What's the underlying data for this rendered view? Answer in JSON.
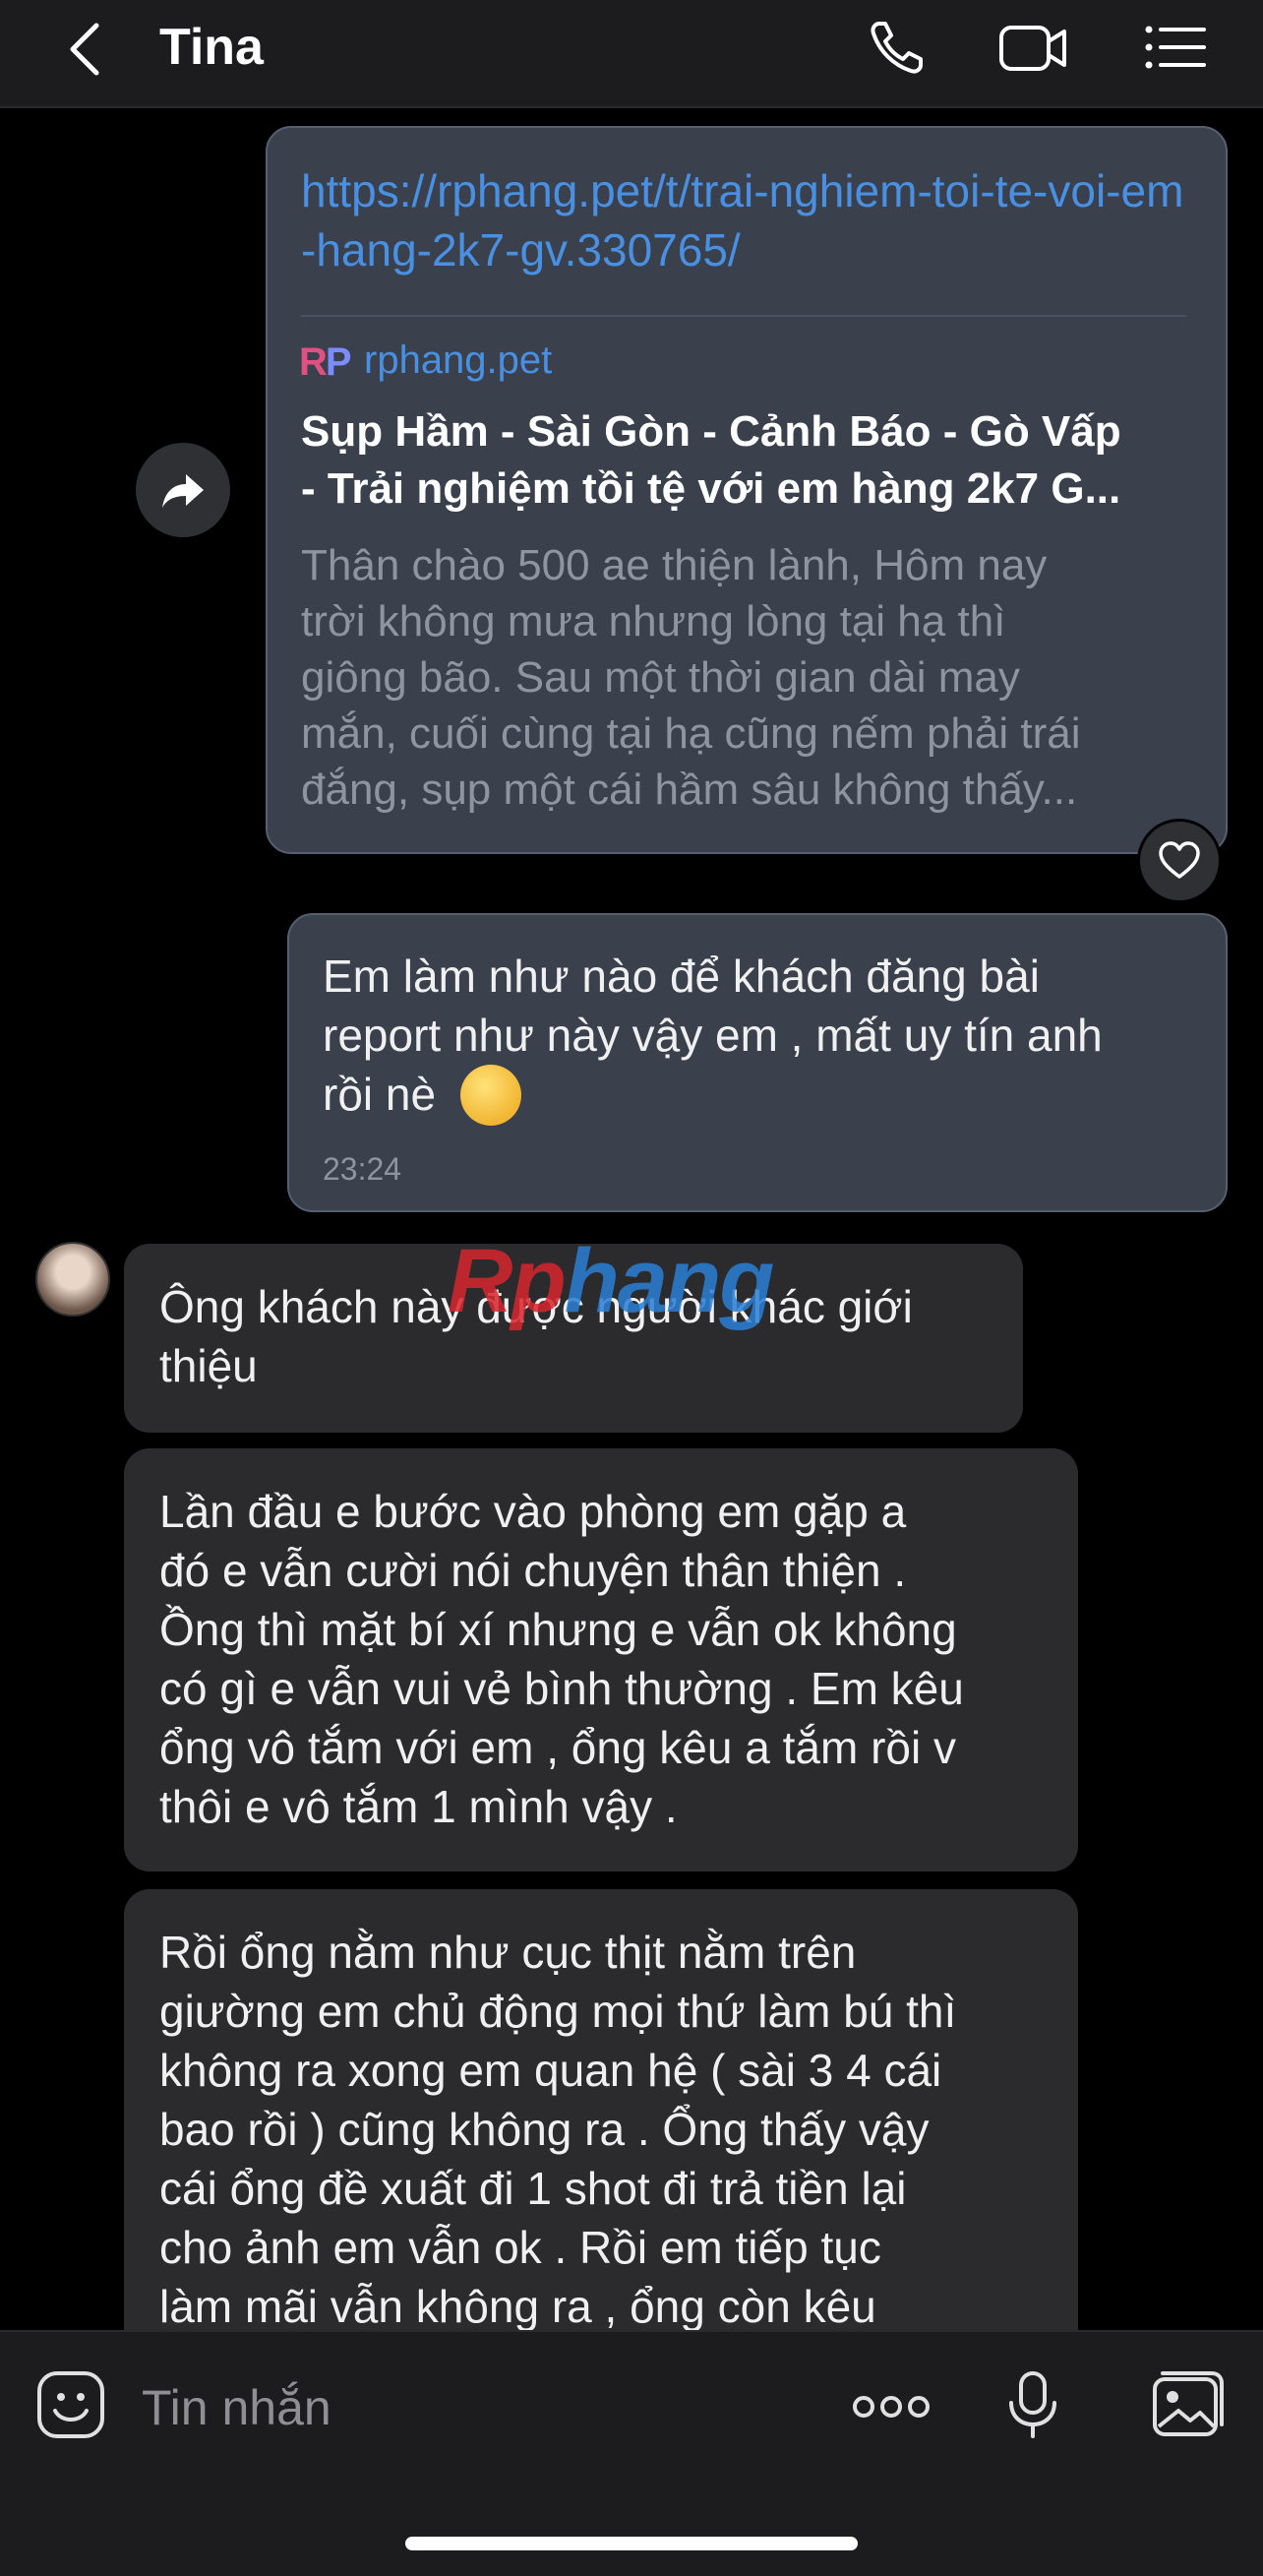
{
  "header": {
    "title": "Tina"
  },
  "link_preview": {
    "url": "https://rphang.pet/t/trai-nghiem-toi-te-voi-em-hang-2k7-gv.330765/",
    "site_logo": "RP",
    "site_domain": "rphang.pet",
    "title": "Sụp Hầm - Sài Gòn - Cảnh Báo - Gò Vấp\n- Trải nghiệm tồi tệ với em hàng 2k7 G...",
    "description": "Thân chào 500 ae thiện lành, Hôm nay\ntrời không mưa nhưng lòng tại hạ thì\ngiông bão. Sau một thời gian dài may\nmắn, cuối cùng tại hạ cũng nếm phải trái\nđắng, sụp một cái hầm sâu không thấy..."
  },
  "messages": [
    {
      "direction": "out",
      "text": "Em làm như nào để khách đăng bài\nreport như này vậy em , mất uy tín anh\nrồi nè",
      "time": "23:24"
    },
    {
      "direction": "in",
      "text": "Ông khách này được người khác giới\nthiệu"
    },
    {
      "direction": "in",
      "text": "Lần đầu e bước vào phòng em gặp a\nđó e vẫn cười nói chuyện thân thiện .\nỒng thì mặt bí xí nhưng e vẫn ok không\ncó gì e vẫn vui vẻ bình thường . Em kêu\nổng vô tắm với em , ổng kêu a tắm rồi v\nthôi e vô tắm 1 mình vậy ."
    },
    {
      "direction": "in",
      "text": "Rồi ổng nằm như cục thịt nằm trên\ngiường em chủ động mọi thứ làm bú thì\nkhông ra xong em quan hệ ( sài 3 4 cái\nbao rồi )  cũng không ra . Ổng thấy vậy\ncái ổng đề xuất đi 1 shot đi trả tiền lại\ncho ảnh em vẫn ok . Rồi em tiếp tục\nlàm mãi vẫn không ra , ổng còn kêu"
    }
  ],
  "watermark": {
    "part1": "Rp",
    "part2": "hang"
  },
  "composer": {
    "placeholder": "Tin nhắn"
  },
  "icons": {
    "back": "back-chevron-icon",
    "call": "phone-icon",
    "video": "video-camera-icon",
    "menu": "list-menu-icon",
    "share": "share-forward-icon",
    "react": "heart-icon",
    "sticker": "sticker-smiley-icon",
    "more": "more-dots-icon",
    "mic": "microphone-icon",
    "image": "image-gallery-icon"
  },
  "colors": {
    "link": "#4a90e2",
    "outgoing_bubble": "#3a404c",
    "incoming_bubble": "#2b2b2d",
    "header_bg": "#1c1c1e"
  }
}
